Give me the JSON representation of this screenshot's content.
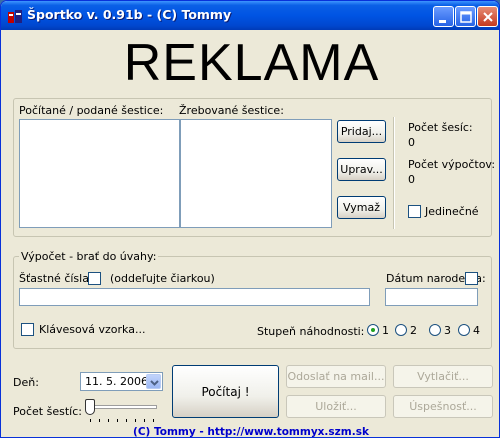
{
  "window": {
    "title": "Športko v. 0.91b - (C) Tommy"
  },
  "banner": {
    "text": "REKLAMA"
  },
  "lists": {
    "counted_label": "Počítané / podané šestice:",
    "drawn_label": "Žrebované šestice:"
  },
  "list_buttons": {
    "add": "Pridaj...",
    "edit": "Uprav...",
    "delete": "Vymaž"
  },
  "stats": {
    "count_sixes_label": "Počet šesíc:",
    "count_sixes_value": "0",
    "count_calc_label": "Počet výpočtov:",
    "count_calc_value": "0",
    "unique_label": "Jedinečné"
  },
  "calc_group": {
    "title": "Výpočet - brať do úvahy:",
    "lucky_label": "Šťastné čísla:",
    "lucky_hint": "(oddeľujte čiarkou)",
    "lucky_value": "",
    "birth_label": "Dátum narodenia:",
    "birth_value": "",
    "keyboard_label": "Klávesová vzorka...",
    "randomness_label": "Stupeň náhodnosti:",
    "randomness_options": [
      "1",
      "2",
      "3",
      "4"
    ],
    "randomness_selected": "1"
  },
  "bottom": {
    "day_label": "Deň:",
    "date_value": "11. 5. 2006",
    "count_label": "Počet šestíc:",
    "count_value": 0,
    "compute_button": "Počítaj !",
    "send_mail_button": "Odoslať na mail...",
    "print_button": "Vytlačiť...",
    "save_button": "Uložiť...",
    "success_button": "Úspešnosť..."
  },
  "footer": {
    "link_text": "(C) Tommy - http://www.tommyx.szm.sk"
  },
  "colors": {
    "titlebar": "#0054e3",
    "window_bg": "#ece9d8",
    "link": "#0000cc"
  }
}
